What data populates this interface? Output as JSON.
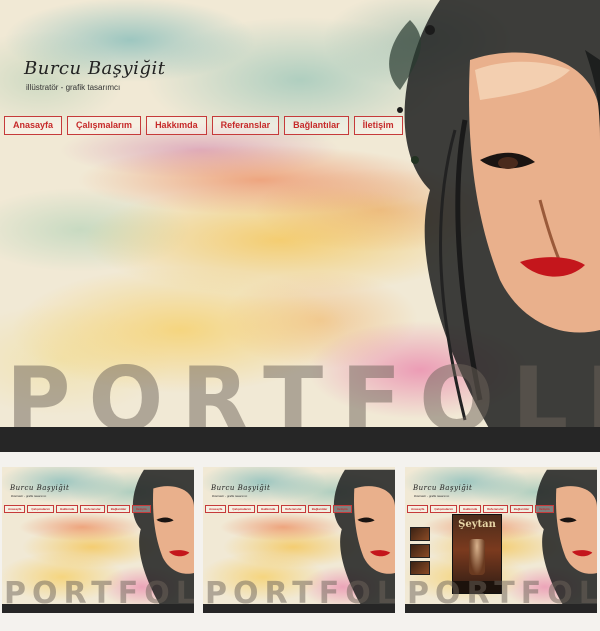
{
  "site": {
    "logo": "Burcu Başyiğit",
    "tagline": "illüstratör - grafik tasarımcı",
    "nav": [
      {
        "label": "Anasayfa"
      },
      {
        "label": "Çalışmalarım"
      },
      {
        "label": "Hakkımda"
      },
      {
        "label": "Referanslar"
      },
      {
        "label": "Bağlantılar"
      },
      {
        "label": "İletişim"
      }
    ],
    "watermark": "PORTFOLIO"
  },
  "thumbnails": [
    {
      "id": "thumb-1"
    },
    {
      "id": "thumb-2"
    },
    {
      "id": "thumb-3",
      "poster_title": "Şeytan"
    }
  ],
  "colors": {
    "nav_text": "#c62a2a",
    "nav_border": "#c63a3a",
    "bar": "#262626",
    "paper": "#f1e9d5"
  }
}
